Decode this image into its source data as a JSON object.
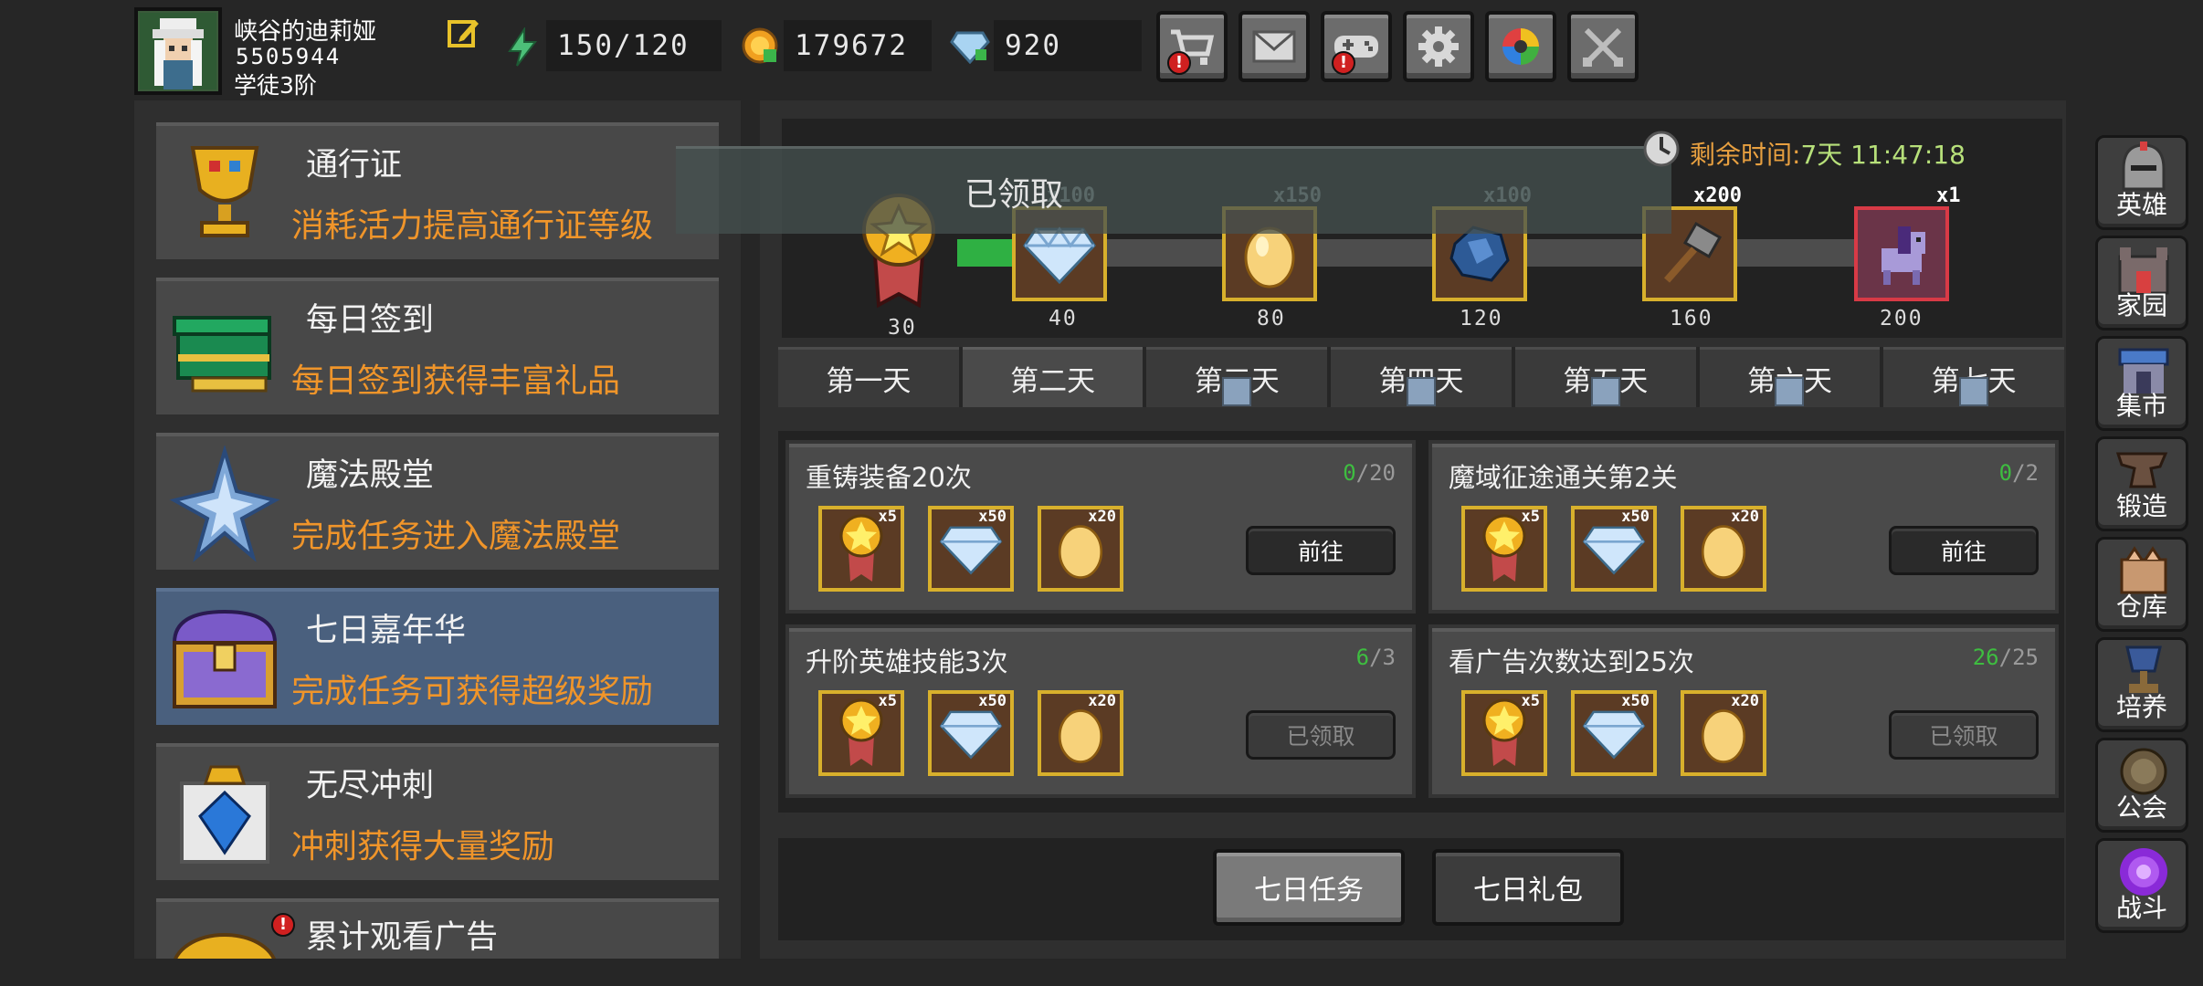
{
  "player": {
    "name": "峡谷的迪莉娅",
    "id": "5505944",
    "rank": "学徒3阶"
  },
  "resources": {
    "energy": "150/120",
    "gold": "179672",
    "gems": "920"
  },
  "top_buttons": [
    "shop-cart-icon",
    "mail-icon",
    "gamepad-icon",
    "settings-gear-icon",
    "color-wheel-icon",
    "swords-icon"
  ],
  "left_menu": [
    {
      "title": "通行证",
      "desc": "消耗活力提高通行证等级"
    },
    {
      "title": "每日签到",
      "desc": "每日签到获得丰富礼品"
    },
    {
      "title": "魔法殿堂",
      "desc": "完成任务进入魔法殿堂"
    },
    {
      "title": "七日嘉年华",
      "desc": "完成任务可获得超级奖励"
    },
    {
      "title": "无尽冲刺",
      "desc": "冲刺获得大量奖励"
    },
    {
      "title": "累计观看广告",
      "desc": ""
    }
  ],
  "banner": {
    "claimed_text": "已领取",
    "timer_label": "剩余时间:",
    "timer_value": "7天 11:47:18"
  },
  "progress": {
    "current": 30,
    "milestones": [
      {
        "points": "40",
        "qty": "x100",
        "item": "diamond-icon"
      },
      {
        "points": "80",
        "qty": "x150",
        "item": "golden-egg-icon"
      },
      {
        "points": "120",
        "qty": "x100",
        "item": "blue-ore-icon"
      },
      {
        "points": "160",
        "qty": "x200",
        "item": "hammer-icon"
      },
      {
        "points": "200",
        "qty": "x1",
        "item": "pony-pet-icon"
      }
    ],
    "medal_points": "30"
  },
  "tabs": [
    "第一天",
    "第二天",
    "第三天",
    "第四天",
    "第五天",
    "第六天",
    "第七天"
  ],
  "tasks": [
    {
      "title": "重铸装备20次",
      "current": "0",
      "total": "/20",
      "button": "前往",
      "rewards": [
        "x5",
        "x50",
        "x20"
      ]
    },
    {
      "title": "魔域征途通关第2关",
      "current": "0",
      "total": "/2",
      "button": "前往",
      "rewards": [
        "x5",
        "x50",
        "x20"
      ]
    },
    {
      "title": "升阶英雄技能3次",
      "current": "6",
      "total": "/3",
      "button": "已领取",
      "rewards": [
        "x5",
        "x50",
        "x20"
      ]
    },
    {
      "title": "看广告次数达到25次",
      "current": "26",
      "total": "/25",
      "button": "已领取",
      "rewards": [
        "x5",
        "x50",
        "x20"
      ]
    }
  ],
  "bottom_buttons": [
    "七日任务",
    "七日礼包"
  ],
  "right_nav": [
    "英雄",
    "家园",
    "集市",
    "锻造",
    "仓库",
    "培养",
    "公会",
    "战斗"
  ]
}
